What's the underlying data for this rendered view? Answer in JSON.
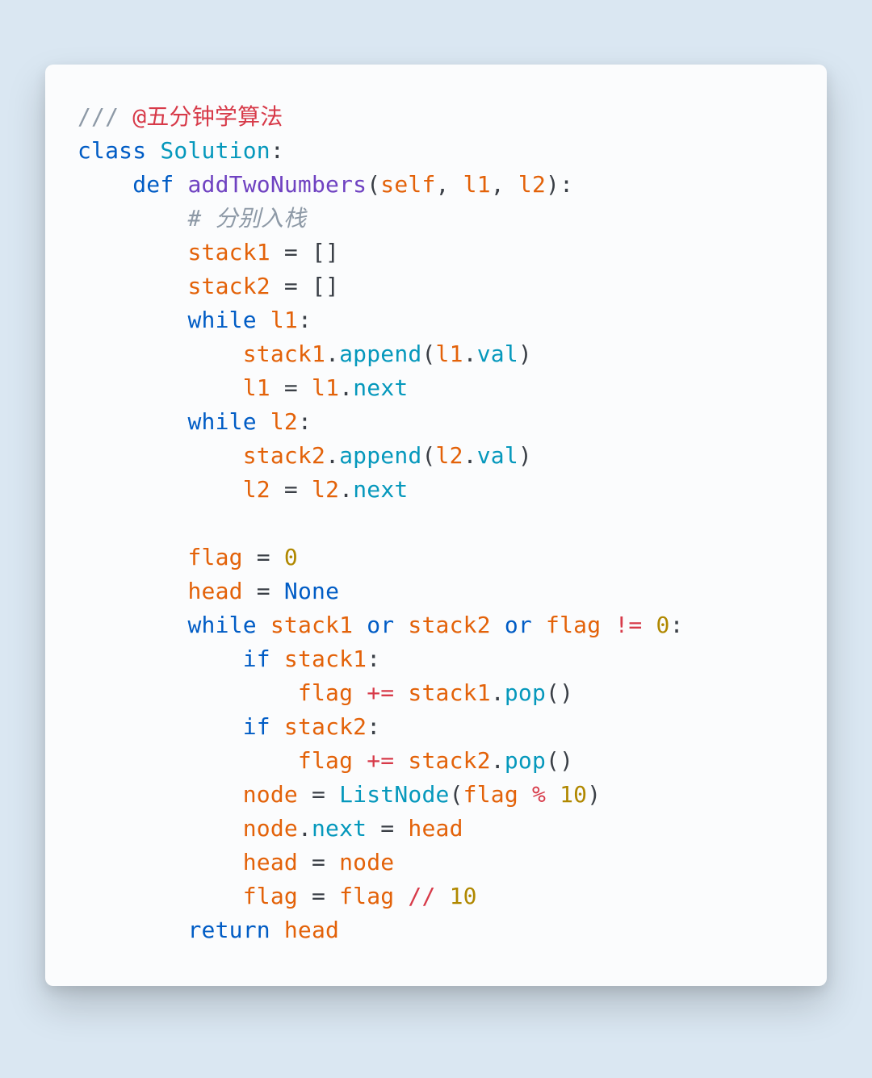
{
  "code": {
    "lines": [
      [
        {
          "t": "/// ",
          "c": "c-gray"
        },
        {
          "t": "@五分钟学算法",
          "c": "c-red"
        }
      ],
      [
        {
          "t": "class ",
          "c": "c-blue"
        },
        {
          "t": "Solution",
          "c": "c-teal"
        },
        {
          "t": ":",
          "c": "c-default"
        }
      ],
      [
        {
          "t": "    ",
          "c": ""
        },
        {
          "t": "def ",
          "c": "c-blue"
        },
        {
          "t": "addTwoNumbers",
          "c": "c-purple"
        },
        {
          "t": "(",
          "c": "c-default"
        },
        {
          "t": "self",
          "c": "c-orange"
        },
        {
          "t": ", ",
          "c": "c-default"
        },
        {
          "t": "l1",
          "c": "c-orange"
        },
        {
          "t": ", ",
          "c": "c-default"
        },
        {
          "t": "l2",
          "c": "c-orange"
        },
        {
          "t": "):",
          "c": "c-default"
        }
      ],
      [
        {
          "t": "        ",
          "c": ""
        },
        {
          "t": "# 分别入栈",
          "c": "c-gray-it"
        }
      ],
      [
        {
          "t": "        ",
          "c": ""
        },
        {
          "t": "stack1 ",
          "c": "c-orange"
        },
        {
          "t": "= []",
          "c": "c-default"
        }
      ],
      [
        {
          "t": "        ",
          "c": ""
        },
        {
          "t": "stack2 ",
          "c": "c-orange"
        },
        {
          "t": "= []",
          "c": "c-default"
        }
      ],
      [
        {
          "t": "        ",
          "c": ""
        },
        {
          "t": "while ",
          "c": "c-blue"
        },
        {
          "t": "l1",
          "c": "c-orange"
        },
        {
          "t": ":",
          "c": "c-default"
        }
      ],
      [
        {
          "t": "            ",
          "c": ""
        },
        {
          "t": "stack1",
          "c": "c-orange"
        },
        {
          "t": ".",
          "c": "c-default"
        },
        {
          "t": "append",
          "c": "c-teal"
        },
        {
          "t": "(",
          "c": "c-default"
        },
        {
          "t": "l1",
          "c": "c-orange"
        },
        {
          "t": ".",
          "c": "c-default"
        },
        {
          "t": "val",
          "c": "c-teal"
        },
        {
          "t": ")",
          "c": "c-default"
        }
      ],
      [
        {
          "t": "            ",
          "c": ""
        },
        {
          "t": "l1 ",
          "c": "c-orange"
        },
        {
          "t": "= ",
          "c": "c-default"
        },
        {
          "t": "l1",
          "c": "c-orange"
        },
        {
          "t": ".",
          "c": "c-default"
        },
        {
          "t": "next",
          "c": "c-teal"
        }
      ],
      [
        {
          "t": "        ",
          "c": ""
        },
        {
          "t": "while ",
          "c": "c-blue"
        },
        {
          "t": "l2",
          "c": "c-orange"
        },
        {
          "t": ":",
          "c": "c-default"
        }
      ],
      [
        {
          "t": "            ",
          "c": ""
        },
        {
          "t": "stack2",
          "c": "c-orange"
        },
        {
          "t": ".",
          "c": "c-default"
        },
        {
          "t": "append",
          "c": "c-teal"
        },
        {
          "t": "(",
          "c": "c-default"
        },
        {
          "t": "l2",
          "c": "c-orange"
        },
        {
          "t": ".",
          "c": "c-default"
        },
        {
          "t": "val",
          "c": "c-teal"
        },
        {
          "t": ")",
          "c": "c-default"
        }
      ],
      [
        {
          "t": "            ",
          "c": ""
        },
        {
          "t": "l2 ",
          "c": "c-orange"
        },
        {
          "t": "= ",
          "c": "c-default"
        },
        {
          "t": "l2",
          "c": "c-orange"
        },
        {
          "t": ".",
          "c": "c-default"
        },
        {
          "t": "next",
          "c": "c-teal"
        }
      ],
      [
        {
          "t": " ",
          "c": ""
        }
      ],
      [
        {
          "t": "        ",
          "c": ""
        },
        {
          "t": "flag ",
          "c": "c-orange"
        },
        {
          "t": "= ",
          "c": "c-default"
        },
        {
          "t": "0",
          "c": "c-gold"
        }
      ],
      [
        {
          "t": "        ",
          "c": ""
        },
        {
          "t": "head ",
          "c": "c-orange"
        },
        {
          "t": "= ",
          "c": "c-default"
        },
        {
          "t": "None",
          "c": "c-blue"
        }
      ],
      [
        {
          "t": "        ",
          "c": ""
        },
        {
          "t": "while ",
          "c": "c-blue"
        },
        {
          "t": "stack1 ",
          "c": "c-orange"
        },
        {
          "t": "or ",
          "c": "c-blue"
        },
        {
          "t": "stack2 ",
          "c": "c-orange"
        },
        {
          "t": "or ",
          "c": "c-blue"
        },
        {
          "t": "flag ",
          "c": "c-orange"
        },
        {
          "t": "!=",
          "c": "c-red"
        },
        {
          "t": " ",
          "c": "c-default"
        },
        {
          "t": "0",
          "c": "c-gold"
        },
        {
          "t": ":",
          "c": "c-default"
        }
      ],
      [
        {
          "t": "            ",
          "c": ""
        },
        {
          "t": "if ",
          "c": "c-blue"
        },
        {
          "t": "stack1",
          "c": "c-orange"
        },
        {
          "t": ":",
          "c": "c-default"
        }
      ],
      [
        {
          "t": "                ",
          "c": ""
        },
        {
          "t": "flag ",
          "c": "c-orange"
        },
        {
          "t": "+=",
          "c": "c-red"
        },
        {
          "t": " ",
          "c": "c-default"
        },
        {
          "t": "stack1",
          "c": "c-orange"
        },
        {
          "t": ".",
          "c": "c-default"
        },
        {
          "t": "pop",
          "c": "c-teal"
        },
        {
          "t": "()",
          "c": "c-default"
        }
      ],
      [
        {
          "t": "            ",
          "c": ""
        },
        {
          "t": "if ",
          "c": "c-blue"
        },
        {
          "t": "stack2",
          "c": "c-orange"
        },
        {
          "t": ":",
          "c": "c-default"
        }
      ],
      [
        {
          "t": "                ",
          "c": ""
        },
        {
          "t": "flag ",
          "c": "c-orange"
        },
        {
          "t": "+=",
          "c": "c-red"
        },
        {
          "t": " ",
          "c": "c-default"
        },
        {
          "t": "stack2",
          "c": "c-orange"
        },
        {
          "t": ".",
          "c": "c-default"
        },
        {
          "t": "pop",
          "c": "c-teal"
        },
        {
          "t": "()",
          "c": "c-default"
        }
      ],
      [
        {
          "t": "            ",
          "c": ""
        },
        {
          "t": "node ",
          "c": "c-orange"
        },
        {
          "t": "= ",
          "c": "c-default"
        },
        {
          "t": "ListNode",
          "c": "c-teal"
        },
        {
          "t": "(",
          "c": "c-default"
        },
        {
          "t": "flag ",
          "c": "c-orange"
        },
        {
          "t": "%",
          "c": "c-red"
        },
        {
          "t": " ",
          "c": "c-default"
        },
        {
          "t": "10",
          "c": "c-gold"
        },
        {
          "t": ")",
          "c": "c-default"
        }
      ],
      [
        {
          "t": "            ",
          "c": ""
        },
        {
          "t": "node",
          "c": "c-orange"
        },
        {
          "t": ".",
          "c": "c-default"
        },
        {
          "t": "next ",
          "c": "c-teal"
        },
        {
          "t": "= ",
          "c": "c-default"
        },
        {
          "t": "head",
          "c": "c-orange"
        }
      ],
      [
        {
          "t": "            ",
          "c": ""
        },
        {
          "t": "head ",
          "c": "c-orange"
        },
        {
          "t": "= ",
          "c": "c-default"
        },
        {
          "t": "node",
          "c": "c-orange"
        }
      ],
      [
        {
          "t": "            ",
          "c": ""
        },
        {
          "t": "flag ",
          "c": "c-orange"
        },
        {
          "t": "= ",
          "c": "c-default"
        },
        {
          "t": "flag ",
          "c": "c-orange"
        },
        {
          "t": "//",
          "c": "c-red"
        },
        {
          "t": " ",
          "c": "c-default"
        },
        {
          "t": "10",
          "c": "c-gold"
        }
      ],
      [
        {
          "t": "        ",
          "c": ""
        },
        {
          "t": "return ",
          "c": "c-blue"
        },
        {
          "t": "head",
          "c": "c-orange"
        }
      ]
    ]
  }
}
